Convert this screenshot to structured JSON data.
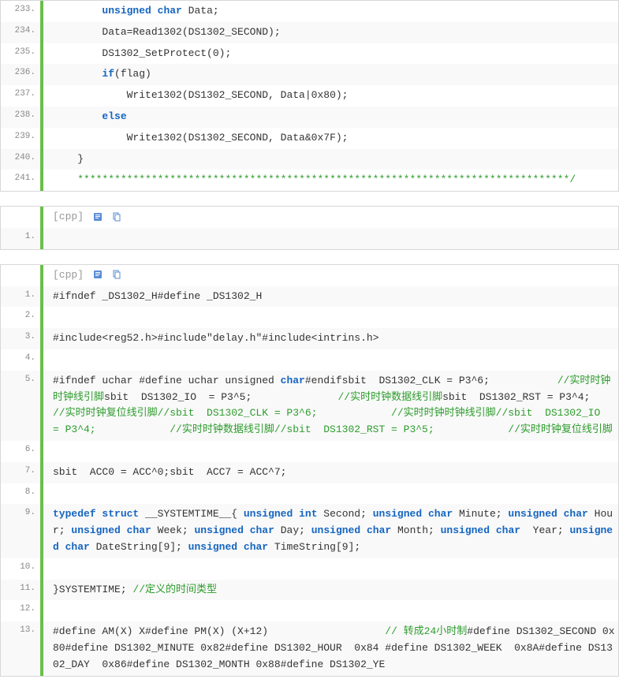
{
  "blocks": [
    {
      "header": null,
      "start": 233,
      "lines": [
        [
          [
            "id",
            "        "
          ],
          [
            "kw",
            "unsigned"
          ],
          [
            "id",
            " "
          ],
          [
            "kw",
            "char"
          ],
          [
            "id",
            " Data;  "
          ]
        ],
        [
          [
            "id",
            "        Data=Read1302(DS1302_SECOND);  "
          ]
        ],
        [
          [
            "id",
            "        DS1302_SetProtect(0);  "
          ]
        ],
        [
          [
            "id",
            "        "
          ],
          [
            "kw",
            "if"
          ],
          [
            "id",
            "(flag)  "
          ]
        ],
        [
          [
            "id",
            "            Write1302(DS1302_SECOND, Data|0x80);  "
          ]
        ],
        [
          [
            "id",
            "        "
          ],
          [
            "kw",
            "else"
          ],
          [
            "id",
            "  "
          ]
        ],
        [
          [
            "id",
            "            Write1302(DS1302_SECOND, Data&0x7F);  "
          ]
        ],
        [
          [
            "id",
            "    }  "
          ]
        ],
        [
          [
            "cm",
            "    ********************************************************************************/"
          ],
          [
            "id",
            "  "
          ]
        ]
      ]
    },
    {
      "header": "[cpp]",
      "start": 1,
      "lines": [
        [
          [
            "id",
            "  "
          ]
        ]
      ]
    },
    {
      "header": "[cpp]",
      "start": 1,
      "lines": [
        [
          [
            "id",
            "#ifndef _DS1302_H#define _DS1302_H  "
          ]
        ],
        [
          [
            "id",
            "  "
          ]
        ],
        [
          [
            "id",
            "#include<reg52.h>#include"
          ],
          [
            "st",
            "\"delay.h\""
          ],
          [
            "id",
            "#include<intrins.h>  "
          ]
        ],
        [
          [
            "id",
            "  "
          ]
        ],
        [
          [
            "id",
            "#ifndef uchar #define uchar unsigned "
          ],
          [
            "kw",
            "char"
          ],
          [
            "id",
            "#endifsbit  DS1302_CLK = P3^6;           "
          ],
          [
            "cm",
            "//实时时钟时钟线引脚"
          ],
          [
            "id",
            "sbit  DS1302_IO  = P3^5;              "
          ],
          [
            "cm",
            "//实时时钟数据线引脚"
          ],
          [
            "id",
            "sbit  DS1302_RST = P3^4;              "
          ],
          [
            "cm",
            "//实时时钟复位线引脚//sbit  DS1302_CLK = P3^6;            //实时时钟时钟线引脚//sbit  DS1302_IO  = P3^4;            //实时时钟数据线引脚//sbit  DS1302_RST = P3^5;            //实时时钟复位线引脚  "
          ]
        ],
        [
          [
            "id",
            "  "
          ]
        ],
        [
          [
            "id",
            "sbit  ACC0 = ACC^0;sbit  ACC7 = ACC^7;  "
          ]
        ],
        [
          [
            "id",
            "  "
          ]
        ],
        [
          [
            "kw",
            "typedef"
          ],
          [
            "id",
            " "
          ],
          [
            "kw",
            "struct"
          ],
          [
            "id",
            " __SYSTEMTIME__{ "
          ],
          [
            "kw",
            "unsigned"
          ],
          [
            "id",
            " "
          ],
          [
            "kw",
            "int"
          ],
          [
            "id",
            " Second; "
          ],
          [
            "kw",
            "unsigned"
          ],
          [
            "id",
            " "
          ],
          [
            "kw",
            "char"
          ],
          [
            "id",
            " Minute; "
          ],
          [
            "kw",
            "unsigned"
          ],
          [
            "id",
            " "
          ],
          [
            "kw",
            "char"
          ],
          [
            "id",
            " Hour; "
          ],
          [
            "kw",
            "unsigned"
          ],
          [
            "id",
            " "
          ],
          [
            "kw",
            "char"
          ],
          [
            "id",
            " Week; "
          ],
          [
            "kw",
            "unsigned"
          ],
          [
            "id",
            " "
          ],
          [
            "kw",
            "char"
          ],
          [
            "id",
            " Day; "
          ],
          [
            "kw",
            "unsigned"
          ],
          [
            "id",
            " "
          ],
          [
            "kw",
            "char"
          ],
          [
            "id",
            " Month; "
          ],
          [
            "kw",
            "unsigned"
          ],
          [
            "id",
            " "
          ],
          [
            "kw",
            "char"
          ],
          [
            "id",
            "  Year; "
          ],
          [
            "kw",
            "unsigned"
          ],
          [
            "id",
            " "
          ],
          [
            "kw",
            "char"
          ],
          [
            "id",
            " DateString[9]; "
          ],
          [
            "kw",
            "unsigned"
          ],
          [
            "id",
            " "
          ],
          [
            "kw",
            "char"
          ],
          [
            "id",
            " TimeString[9];  "
          ]
        ],
        [
          [
            "id",
            "  "
          ]
        ],
        [
          [
            "id",
            "}SYSTEMTIME; "
          ],
          [
            "cm",
            "//定义的时间类型  "
          ]
        ],
        [
          [
            "id",
            "  "
          ]
        ],
        [
          [
            "id",
            "#define AM(X) X#define PM(X) (X+12)                   "
          ],
          [
            "cm",
            "// 转成24小时制"
          ],
          [
            "id",
            "#define DS1302_SECOND 0x80#define DS1302_MINUTE 0x82#define DS1302_HOUR  0x84 #define DS1302_WEEK  0x8A#define DS1302_DAY  0x86#define DS1302_MONTH 0x88#define DS1302_YE"
          ]
        ]
      ]
    }
  ],
  "icons": {
    "view_label": "view plain",
    "copy_label": "copy"
  }
}
